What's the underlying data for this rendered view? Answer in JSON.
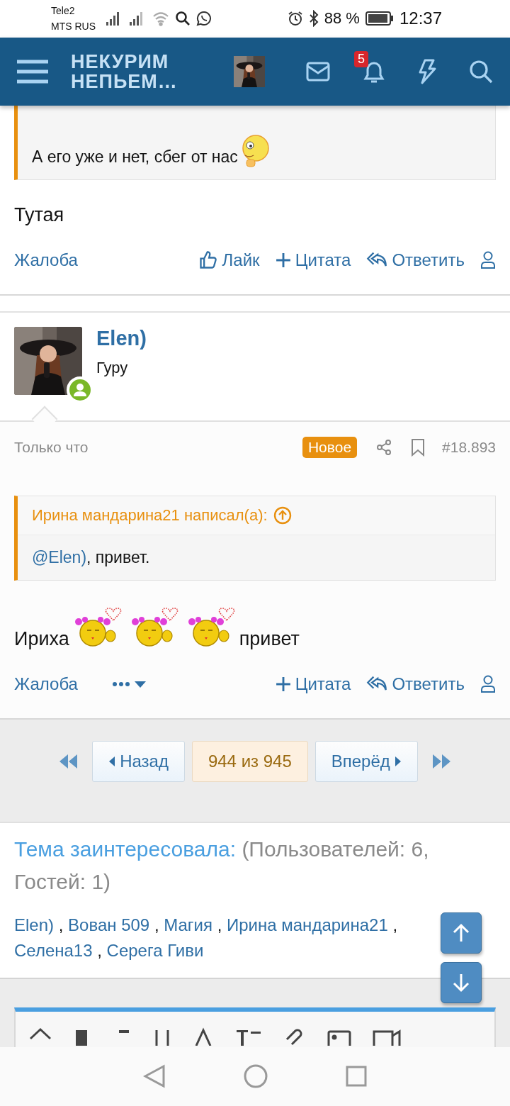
{
  "status_bar": {
    "carriers": [
      "Tele2",
      "MTS RUS"
    ],
    "battery": "88 %",
    "time": "12:37"
  },
  "header": {
    "logo": [
      "НЕКУРИМ",
      "НЕПЬЕМ…"
    ],
    "notifications": "5"
  },
  "posts": [
    {
      "quote": {
        "segments": [
          {
            "kind": "text",
            "text": "А его уже и нет, сбег от нас"
          },
          {
            "kind": "thinking-smiley"
          }
        ]
      },
      "body": [
        {
          "kind": "text",
          "text": "Тутая"
        }
      ],
      "actions": [
        {
          "kind": "report",
          "label": "Жалоба"
        },
        {
          "kind": "like",
          "label": "Лайк"
        },
        {
          "kind": "quote",
          "label": "Цитата"
        },
        {
          "kind": "reply",
          "label": "Ответить"
        },
        {
          "kind": "profile"
        }
      ]
    },
    {
      "author": {
        "name": "Elen)",
        "title": "Гуру",
        "online": true
      },
      "time": "Только что",
      "badge": "Новое",
      "number": "#18.893",
      "quote": {
        "author": "Ирина мандарина21 написал(а):",
        "mention": "@Elen)",
        "segments": [
          {
            "kind": "text",
            "text": ", привет."
          }
        ]
      },
      "body": [
        {
          "kind": "text",
          "text": "Ириха"
        },
        {
          "kind": "kiss-smiley"
        },
        {
          "kind": "kiss-smiley"
        },
        {
          "kind": "kiss-smiley"
        },
        {
          "kind": "text",
          "text": "привет"
        }
      ],
      "actions": [
        {
          "kind": "report",
          "label": "Жалоба"
        },
        {
          "kind": "menu"
        },
        {
          "kind": "quote",
          "label": "Цитата"
        },
        {
          "kind": "reply",
          "label": "Ответить"
        },
        {
          "kind": "profile"
        }
      ]
    }
  ],
  "pagination": {
    "prev": "Назад",
    "current": "944 из 945",
    "next": "Вперёд"
  },
  "interested": {
    "title": "Тема заинтересовала:",
    "counts": "(Пользователей: 6, Гостей: 1)",
    "users": [
      {
        "name": "Elen)",
        "separator": ","
      },
      {
        "name": "Вован 509",
        "separator": ","
      },
      {
        "name": "Магия",
        "separator": ","
      },
      {
        "name": "Ирина мандарина21",
        "separator": ","
      },
      {
        "name": "Селена13",
        "separator": ","
      },
      {
        "name": "Серега Гиви"
      }
    ]
  }
}
